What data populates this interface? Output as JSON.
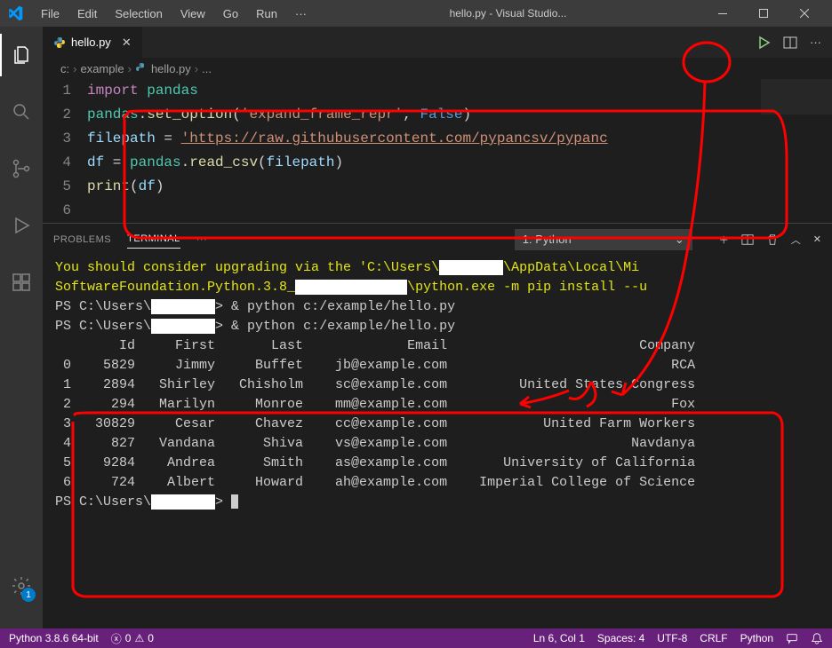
{
  "window": {
    "title": "hello.py - Visual Studio..."
  },
  "menu": {
    "items": [
      "File",
      "Edit",
      "Selection",
      "View",
      "Go",
      "Run",
      "···"
    ]
  },
  "tab": {
    "filename": "hello.py"
  },
  "breadcrumbs": {
    "folder": "c:",
    "sub": "example",
    "file": "hello.py",
    "tail": "..."
  },
  "code": {
    "lines": [
      {
        "n": 1,
        "tokens": [
          [
            "c-key",
            "import"
          ],
          [
            "",
            " "
          ],
          [
            "c-mod",
            "pandas"
          ]
        ]
      },
      {
        "n": 2,
        "tokens": [
          [
            "c-mod",
            "pandas"
          ],
          [
            "",
            "."
          ],
          [
            "c-fn",
            "set_option"
          ],
          [
            "",
            "("
          ],
          [
            "c-str",
            "'expand_frame_repr'"
          ],
          [
            "",
            ", "
          ],
          [
            "c-const",
            "False"
          ],
          [
            "",
            ")"
          ]
        ]
      },
      {
        "n": 3,
        "tokens": [
          [
            "c-var",
            "filepath"
          ],
          [
            "",
            " = "
          ],
          [
            "c-str underline",
            "'https://raw.githubusercontent.com/pypancsv/pypanc"
          ]
        ]
      },
      {
        "n": 4,
        "tokens": [
          [
            "c-var",
            "df"
          ],
          [
            "",
            " = "
          ],
          [
            "c-mod",
            "pandas"
          ],
          [
            "",
            "."
          ],
          [
            "c-fn",
            "read_csv"
          ],
          [
            "",
            "("
          ],
          [
            "c-var",
            "filepath"
          ],
          [
            "",
            ")"
          ]
        ]
      },
      {
        "n": 5,
        "tokens": [
          [
            "c-fn",
            "print"
          ],
          [
            "",
            "("
          ],
          [
            "c-var",
            "df"
          ],
          [
            "",
            ")"
          ]
        ]
      },
      {
        "n": 6,
        "tokens": []
      }
    ]
  },
  "panel": {
    "tabs": {
      "problems": "PROBLEMS",
      "terminal": "TERMINAL",
      "more": "···"
    },
    "dropdown": {
      "label": "1: Python"
    }
  },
  "terminal": {
    "warn_line1": "You should consider upgrading via the 'C:\\Users\\",
    "warn_line1_tail": "\\AppData\\Local\\Mi",
    "warn_line2": "SoftwareFoundation.Python.3.8_",
    "warn_line2_tail": "\\python.exe -m pip install --u",
    "ps_prefix": "PS C:\\Users\\",
    "ps_cmd": " & python c:/example/hello.py",
    "table": {
      "headers": [
        "",
        "Id",
        "First",
        "Last",
        "Email",
        "Company"
      ],
      "rows": [
        [
          "0",
          "5829",
          "Jimmy",
          "Buffet",
          "jb@example.com",
          "RCA"
        ],
        [
          "1",
          "2894",
          "Shirley",
          "Chisholm",
          "sc@example.com",
          "United States Congress"
        ],
        [
          "2",
          "294",
          "Marilyn",
          "Monroe",
          "mm@example.com",
          "Fox"
        ],
        [
          "3",
          "30829",
          "Cesar",
          "Chavez",
          "cc@example.com",
          "United Farm Workers"
        ],
        [
          "4",
          "827",
          "Vandana",
          "Shiva",
          "vs@example.com",
          "Navdanya"
        ],
        [
          "5",
          "9284",
          "Andrea",
          "Smith",
          "as@example.com",
          "University of California"
        ],
        [
          "6",
          "724",
          "Albert",
          "Howard",
          "ah@example.com",
          "Imperial College of Science"
        ]
      ]
    }
  },
  "statusbar": {
    "python": "Python 3.8.6 64-bit",
    "errors": "0",
    "warnings": "0",
    "position": "Ln 6, Col 1",
    "spaces": "Spaces: 4",
    "encoding": "UTF-8",
    "eol": "CRLF",
    "language": "Python"
  },
  "activity": {
    "settings_badge": "1"
  }
}
